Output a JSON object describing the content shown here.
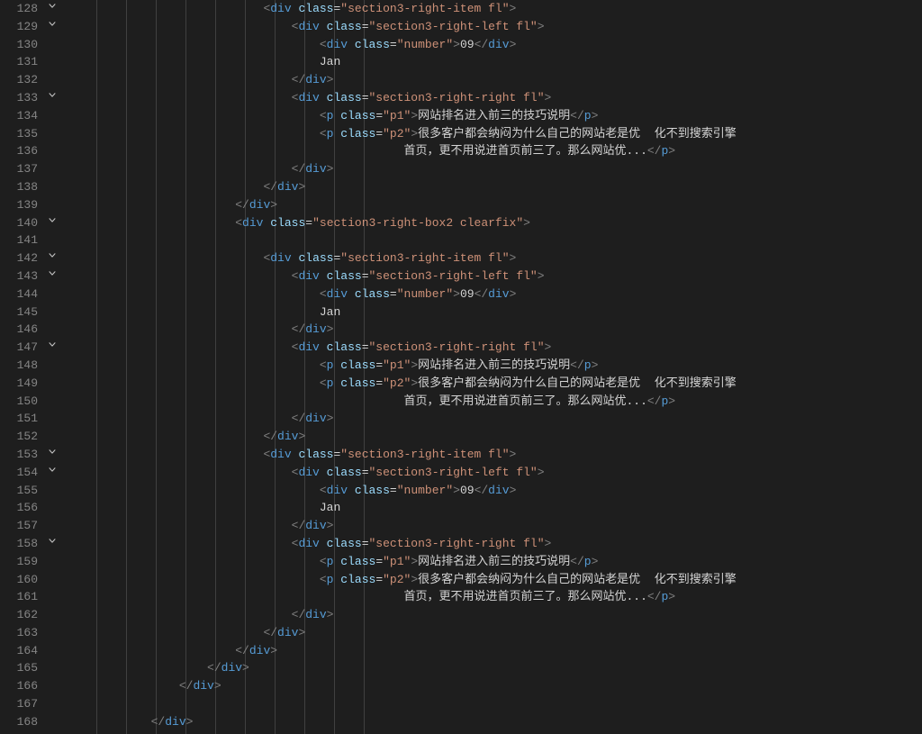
{
  "lineStart": 128,
  "lineEnd": 168,
  "foldable": [
    128,
    129,
    133,
    140,
    142,
    143,
    147,
    153,
    154,
    158
  ],
  "tokens": {
    "div": "div",
    "p": "p",
    "class": "class"
  },
  "strings": {
    "section3_right_item_fl": "\"section3-right-item fl\"",
    "section3_right_left_fl": "\"section3-right-left fl\"",
    "number": "\"number\"",
    "section3_right_right_fl": "\"section3-right-right fl\"",
    "p1": "\"p1\"",
    "p2": "\"p2\"",
    "section3_right_box2_clearfix": "\"section3-right-box2 clearfix\""
  },
  "text": {
    "num09": "09",
    "jan": "Jan",
    "p1_text": "网站排名进入前三的技巧说明",
    "p2_text_a": "很多客户都会纳闷为什么自己的网站老是优  化不到搜索引擎",
    "p2_text_b": "首页，更不用说进首页前三了。那么网站优..."
  },
  "indents": {
    "l128": 7,
    "l129": 8,
    "l130": 9,
    "l131": 9,
    "l132": 8,
    "l133": 8,
    "l134": 9,
    "l135": 9,
    "l136": 12,
    "l137": 8,
    "l138": 7,
    "l139": 6,
    "l140": 6,
    "l141": 0,
    "l142": 7,
    "l143": 8,
    "l144": 9,
    "l145": 9,
    "l146": 8,
    "l147": 8,
    "l148": 9,
    "l149": 9,
    "l150": 12,
    "l151": 8,
    "l152": 7,
    "l153": 7,
    "l154": 8,
    "l155": 9,
    "l156": 9,
    "l157": 8,
    "l158": 8,
    "l159": 9,
    "l160": 9,
    "l161": 12,
    "l162": 8,
    "l163": 7,
    "l164": 6,
    "l165": 5,
    "l166": 4,
    "l167": 0,
    "l168": 3
  }
}
